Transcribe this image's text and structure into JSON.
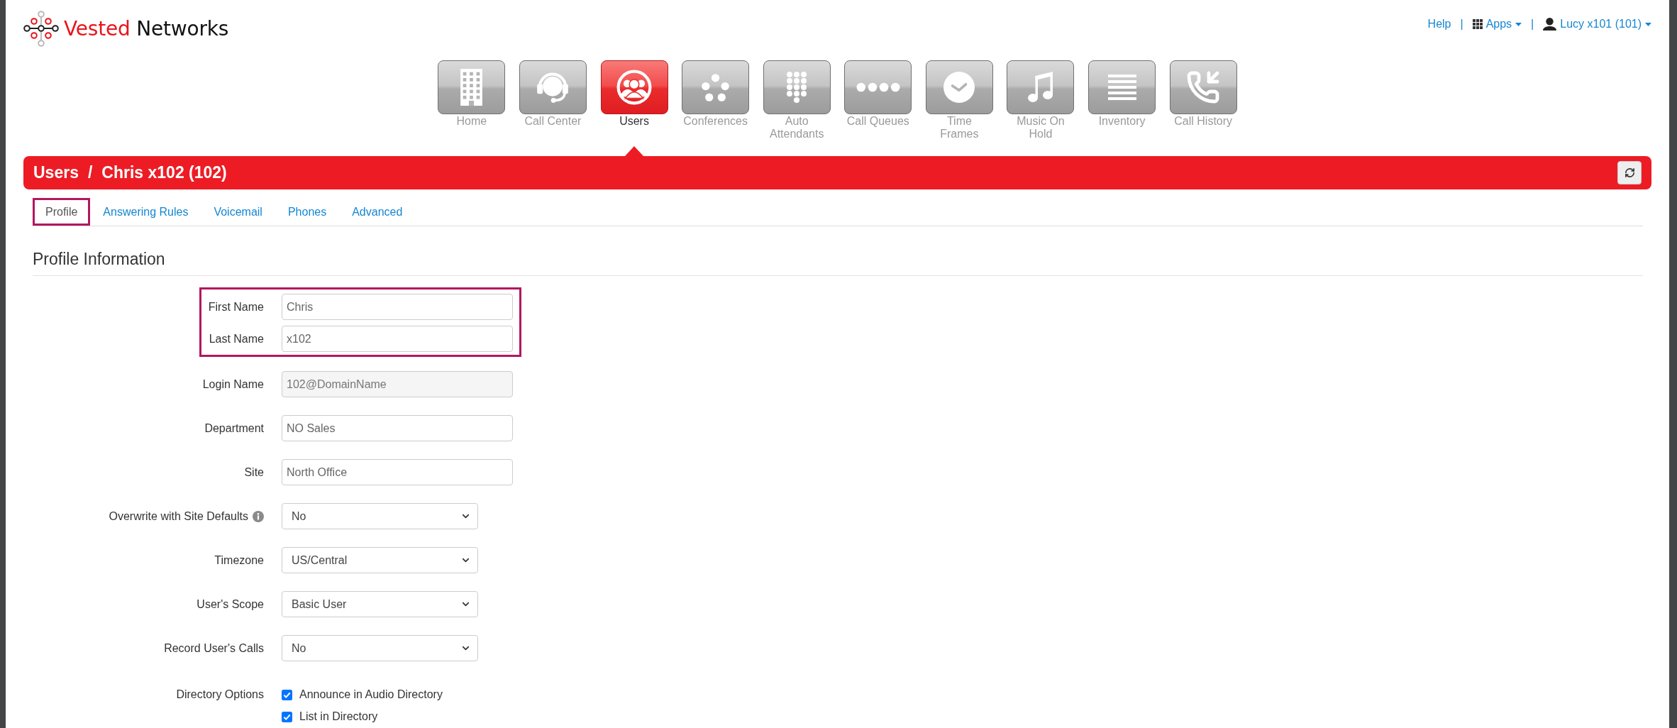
{
  "logo": {
    "primary": "Vested",
    "secondary": "Networks"
  },
  "header_links": [
    {
      "kind": "link",
      "label": "Help"
    },
    {
      "kind": "separator",
      "label": "|"
    },
    {
      "kind": "apps_menu",
      "label": "Apps"
    },
    {
      "kind": "separator",
      "label": "|"
    },
    {
      "kind": "user_menu",
      "label": "Lucy x101 (101)"
    }
  ],
  "nav": {
    "items": [
      {
        "kind": "home",
        "label": "Home",
        "selected": false
      },
      {
        "kind": "call_center",
        "label": "Call Center",
        "selected": false
      },
      {
        "kind": "users",
        "label": "Users",
        "selected": true
      },
      {
        "kind": "conferences",
        "label": "Conferences",
        "selected": false
      },
      {
        "kind": "auto_attendants",
        "label": "Auto Attendants",
        "selected": false
      },
      {
        "kind": "call_queues",
        "label": "Call Queues",
        "selected": false
      },
      {
        "kind": "time_frames",
        "label": "Time Frames",
        "selected": false
      },
      {
        "kind": "music_on_hold",
        "label": "Music On Hold",
        "selected": false
      },
      {
        "kind": "inventory",
        "label": "Inventory",
        "selected": false
      },
      {
        "kind": "call_history",
        "label": "Call History",
        "selected": false
      }
    ]
  },
  "title_bar": {
    "section": "Users",
    "separator": "/",
    "title": "Chris x102 (102)"
  },
  "tabs": [
    {
      "label": "Profile",
      "selected": true,
      "highlighted": true
    },
    {
      "label": "Answering Rules",
      "selected": false,
      "highlighted": false
    },
    {
      "label": "Voicemail",
      "selected": false,
      "highlighted": false
    },
    {
      "label": "Phones",
      "selected": false,
      "highlighted": false
    },
    {
      "label": "Advanced",
      "selected": false,
      "highlighted": false
    }
  ],
  "section_title": "Profile Information",
  "form": {
    "groups": [
      {
        "highlighted": true,
        "rows": [
          {
            "kind": "text",
            "label": "First Name",
            "value": "Chris",
            "disabled": false
          },
          {
            "kind": "text",
            "label": "Last Name",
            "value": "x102",
            "disabled": false
          }
        ]
      },
      {
        "highlighted": false,
        "rows": [
          {
            "kind": "text",
            "label": "Login Name",
            "value": "102@DomainName",
            "disabled": true
          },
          {
            "kind": "text",
            "label": "Department",
            "value": "NO Sales",
            "disabled": false
          },
          {
            "kind": "text",
            "label": "Site",
            "value": "North Office",
            "disabled": false
          },
          {
            "kind": "select",
            "label": "Overwrite with Site Defaults",
            "value": "No",
            "disabled": false,
            "info": true
          },
          {
            "kind": "select",
            "label": "Timezone",
            "value": "US/Central",
            "disabled": false
          },
          {
            "kind": "select",
            "label": "User's Scope",
            "value": "Basic User",
            "disabled": false
          },
          {
            "kind": "select",
            "label": "Record User's Calls",
            "value": "No",
            "disabled": false
          },
          {
            "kind": "checkboxes",
            "label": "Directory Options",
            "disabled": false,
            "options": [
              {
                "label": "Announce in Audio Directory",
                "checked": true
              },
              {
                "label": "List in Directory",
                "checked": true
              }
            ]
          }
        ]
      }
    ]
  }
}
